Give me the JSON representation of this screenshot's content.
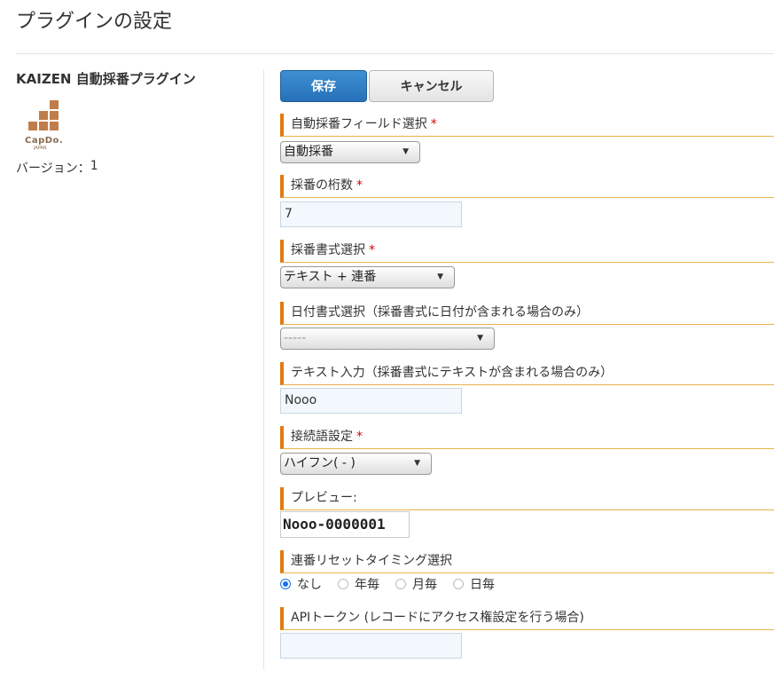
{
  "page": {
    "title": "プラグインの設定"
  },
  "plugin": {
    "name": "KAIZEN 自動採番プラグイン",
    "logo_text": "CapDo.",
    "logo_subtext": "JAPAN",
    "version_label": "バージョン：",
    "version": "1"
  },
  "toolbar": {
    "save_label": "保存",
    "cancel_label": "キャンセル"
  },
  "fields": {
    "auto_field": {
      "label": "自動採番フィールド選択",
      "required": "*",
      "value": "自動採番"
    },
    "digits": {
      "label": "採番の桁数",
      "required": "*",
      "value": "7"
    },
    "format": {
      "label": "採番書式選択",
      "required": "*",
      "value": "テキスト + 連番"
    },
    "date_format": {
      "label": "日付書式選択（採番書式に日付が含まれる場合のみ）",
      "value": "-----"
    },
    "text_input": {
      "label": "テキスト入力（採番書式にテキストが含まれる場合のみ）",
      "value": "Nooo"
    },
    "connector": {
      "label": "接続語設定",
      "required": "*",
      "value": "ハイフン( - )"
    },
    "preview": {
      "label": "プレビュー:",
      "value": "Nooo-0000001"
    },
    "reset_timing": {
      "label": "連番リセットタイミング選択",
      "options": [
        "なし",
        "年毎",
        "月毎",
        "日毎"
      ],
      "selected": "なし"
    },
    "api_token": {
      "label": "APIトークン (レコードにアクセス権設定を行う場合)",
      "value": ""
    }
  },
  "colors": {
    "accent": "#e07b12",
    "primary_button": "#2a78bf",
    "required": "#dd0000"
  }
}
